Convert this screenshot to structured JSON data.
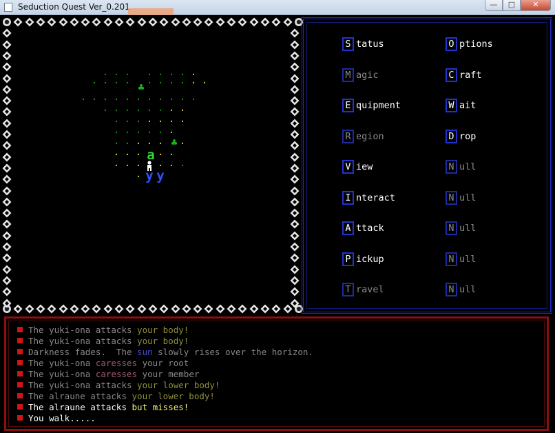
{
  "window": {
    "title": "Seduction Quest Ver_0.201",
    "min_label": "—",
    "max_label": "□",
    "close_label": "✕"
  },
  "colors": {
    "map_green": "#1aa51a",
    "map_yellow": "#e8e020",
    "enemy_alraune": "#2ed82e",
    "enemy_yuki": "#2f50ff",
    "command_border": "#2233cc",
    "log_border": "#8b0f0f",
    "text_grey": "#8a8a8a",
    "text_olive": "#8f8f3a",
    "text_pink": "#a05a78",
    "text_blue": "#4a4ad0",
    "text_yellow": "#f4f47a",
    "text_white": "#ffffff"
  },
  "map": {
    "player_icon": "player-figure-icon",
    "tree_icon": "club-tree-icon",
    "border_icon": "diamond-tile-icon",
    "alraune_glyph": "a",
    "yuki_glyph": "y"
  },
  "commands": [
    {
      "key": "S",
      "label": "tatus",
      "enabled": true
    },
    {
      "key": "O",
      "label": "ptions",
      "enabled": true
    },
    {
      "key": "M",
      "label": "agic",
      "enabled": false
    },
    {
      "key": "C",
      "label": "raft",
      "enabled": true
    },
    {
      "key": "E",
      "label": "quipment",
      "enabled": true
    },
    {
      "key": "W",
      "label": "ait",
      "enabled": true
    },
    {
      "key": "R",
      "label": "egion",
      "enabled": false
    },
    {
      "key": "D",
      "label": "rop",
      "enabled": true
    },
    {
      "key": "V",
      "label": "iew",
      "enabled": true
    },
    {
      "key": "N",
      "label": "ull",
      "enabled": false
    },
    {
      "key": "I",
      "label": "nteract",
      "enabled": true
    },
    {
      "key": "N",
      "label": "ull",
      "enabled": false
    },
    {
      "key": "A",
      "label": "ttack",
      "enabled": true
    },
    {
      "key": "N",
      "label": "ull",
      "enabled": false
    },
    {
      "key": "P",
      "label": "ickup",
      "enabled": true
    },
    {
      "key": "N",
      "label": "ull",
      "enabled": false
    },
    {
      "key": "T",
      "label": "ravel",
      "enabled": false
    },
    {
      "key": "N",
      "label": "ull",
      "enabled": false
    }
  ],
  "log": [
    {
      "segments": [
        {
          "text": "The yuki-ona attacks ",
          "color": "#8a8a8a"
        },
        {
          "text": "your body!",
          "color": "#8f8f3a"
        }
      ]
    },
    {
      "segments": [
        {
          "text": "The yuki-ona attacks ",
          "color": "#8a8a8a"
        },
        {
          "text": "your body!",
          "color": "#8f8f3a"
        }
      ]
    },
    {
      "segments": [
        {
          "text": "Darkness fades.  The ",
          "color": "#8a8a8a"
        },
        {
          "text": "sun",
          "color": "#4a4ad0"
        },
        {
          "text": " slowly rises over the horizon.",
          "color": "#8a8a8a"
        }
      ]
    },
    {
      "segments": [
        {
          "text": "The yuki-ona ",
          "color": "#8a8a8a"
        },
        {
          "text": "caresses",
          "color": "#a05a78"
        },
        {
          "text": " your root",
          "color": "#8a8a8a"
        }
      ]
    },
    {
      "segments": [
        {
          "text": "The yuki-ona ",
          "color": "#8a8a8a"
        },
        {
          "text": "caresses",
          "color": "#a05a78"
        },
        {
          "text": " your member",
          "color": "#8a8a8a"
        }
      ]
    },
    {
      "segments": [
        {
          "text": "The yuki-ona attacks ",
          "color": "#8a8a8a"
        },
        {
          "text": "your lower body!",
          "color": "#8f8f3a"
        }
      ]
    },
    {
      "segments": [
        {
          "text": "The alraune attacks ",
          "color": "#8a8a8a"
        },
        {
          "text": "your lower body!",
          "color": "#8f8f3a"
        }
      ]
    },
    {
      "segments": [
        {
          "text": "The alraune attacks ",
          "color": "#ffffff"
        },
        {
          "text": "but misses!",
          "color": "#f4f47a"
        }
      ]
    },
    {
      "segments": [
        {
          "text": "You walk.....",
          "color": "#ffffff"
        }
      ]
    }
  ]
}
